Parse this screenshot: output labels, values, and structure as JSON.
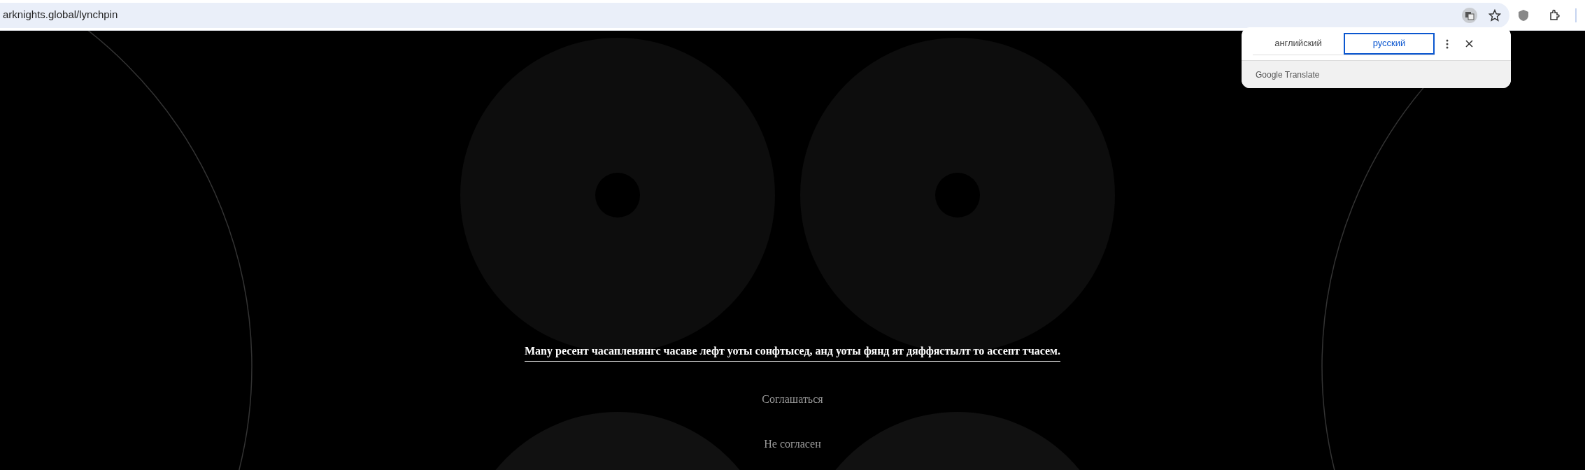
{
  "address_bar": {
    "url": "arknights.global/lynchpin"
  },
  "translate_popup": {
    "languages": [
      {
        "label": "английский",
        "selected": false
      },
      {
        "label": "русский",
        "selected": true
      }
    ],
    "footer": "Google Translate"
  },
  "page": {
    "message": "Many ресент часапленянгс часаве лефт уоты сонфтысед, анд уоты фянд ят дяффястылт то ассепт тчасем.",
    "buttons": [
      "Соглашаться",
      "Не согласен"
    ]
  }
}
